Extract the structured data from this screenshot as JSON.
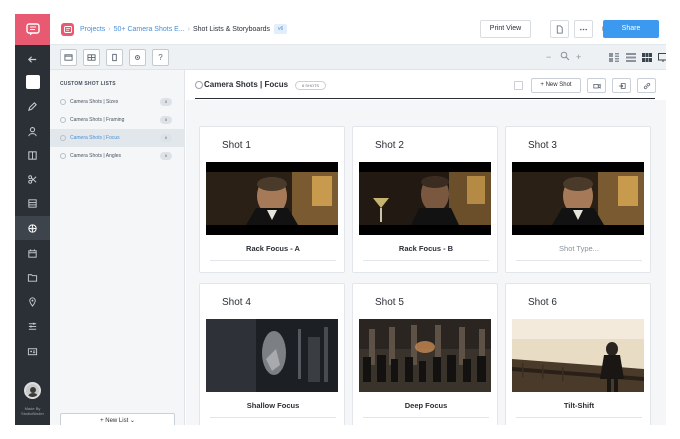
{
  "app": {
    "brand_color": "#e85a71",
    "accent_color": "#3b9af0"
  },
  "breadcrumb": {
    "root": "Projects",
    "project": "50+ Camera Shots E...",
    "page": "Shot Lists & Storyboards",
    "version": "v6"
  },
  "topbar": {
    "print_label": "Print View",
    "share_label": "Share"
  },
  "sidebar": {
    "title": "CUSTOM SHOT LISTS",
    "items": [
      {
        "label": "Camera Shots | Sizes",
        "count": "8"
      },
      {
        "label": "Camera Shots | Framing",
        "count": "8"
      },
      {
        "label": "Camera Shots | Focus",
        "count": "6"
      },
      {
        "label": "Camera Shots | Angles",
        "count": "8"
      }
    ],
    "new_list_label": "+  New List  ⌄",
    "made_by": "Made By StudioBinder"
  },
  "list": {
    "title": "Camera Shots | Focus",
    "shot_count": "6 SHOTS",
    "new_shot_label": "+  New Shot"
  },
  "shots": [
    {
      "number": "Shot 1",
      "caption": "Rack Focus - A",
      "placeholder": false
    },
    {
      "number": "Shot 2",
      "caption": "Rack Focus - B",
      "placeholder": false
    },
    {
      "number": "Shot 3",
      "caption": "Shot Type...",
      "placeholder": true
    },
    {
      "number": "Shot 4",
      "caption": "Shallow Focus",
      "placeholder": false
    },
    {
      "number": "Shot 5",
      "caption": "Deep Focus",
      "placeholder": false
    },
    {
      "number": "Shot 6",
      "caption": "Tilt-Shift",
      "placeholder": false
    }
  ]
}
